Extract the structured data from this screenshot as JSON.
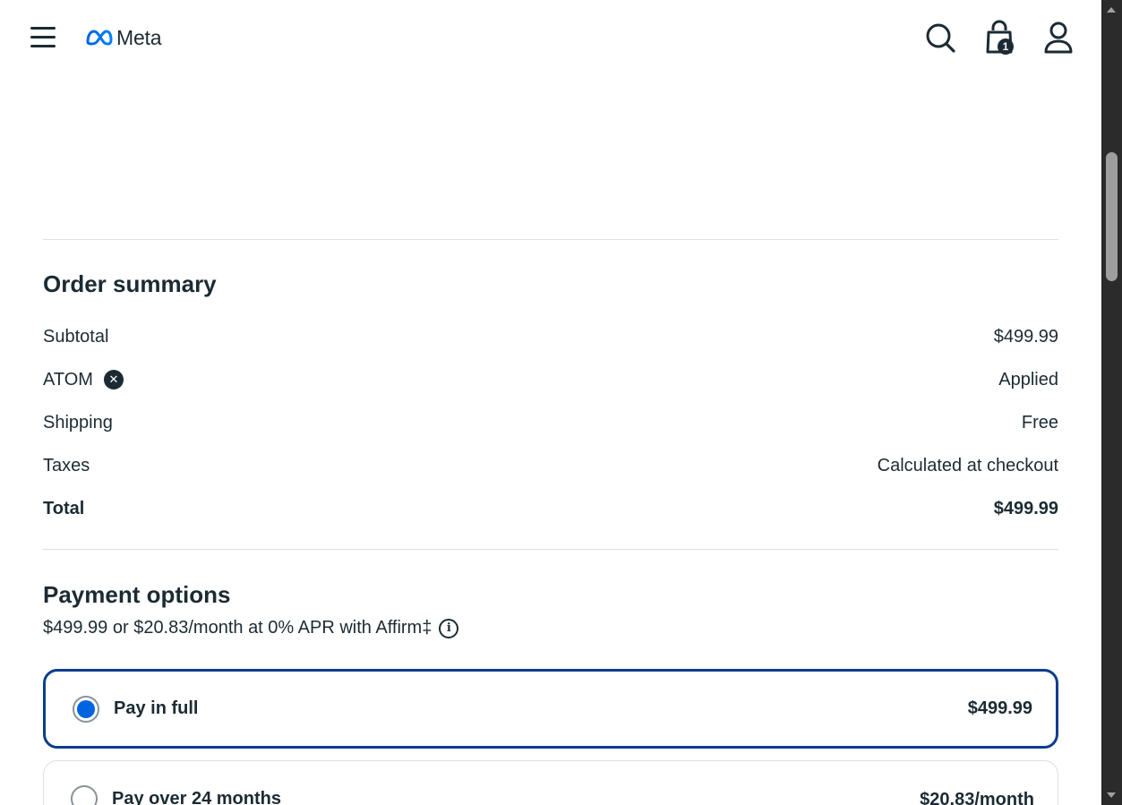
{
  "header": {
    "brand": "Meta",
    "cart_count": "1",
    "icons": {
      "menu": "hamburger-menu-icon",
      "logo": "meta-infinity-logo",
      "search": "search-icon",
      "bag": "shopping-bag-icon",
      "account": "user-icon"
    }
  },
  "order_summary": {
    "title": "Order summary",
    "rows": [
      {
        "label": "Subtotal",
        "value": "$499.99"
      },
      {
        "label": "ATOM",
        "value": "Applied"
      },
      {
        "label": "Shipping",
        "value": "Free"
      },
      {
        "label": "Taxes",
        "value": "Calculated at checkout"
      },
      {
        "label": "Total",
        "value": "$499.99"
      }
    ]
  },
  "payment": {
    "title": "Payment options",
    "affirm_text": "$499.99 or $20.83/month at 0% APR with Affirm‡",
    "options": [
      {
        "label": "Pay in full",
        "price": "$499.99",
        "selected": true
      },
      {
        "label": "Pay over 24 months",
        "price": "$20.83/month",
        "selected": false
      }
    ]
  },
  "colors": {
    "text": "#1c2b33",
    "selected_border": "#0a3e8c",
    "radio_fill": "#0064e0",
    "divider": "#dde1e4",
    "meta_blue": "#0081fb"
  }
}
